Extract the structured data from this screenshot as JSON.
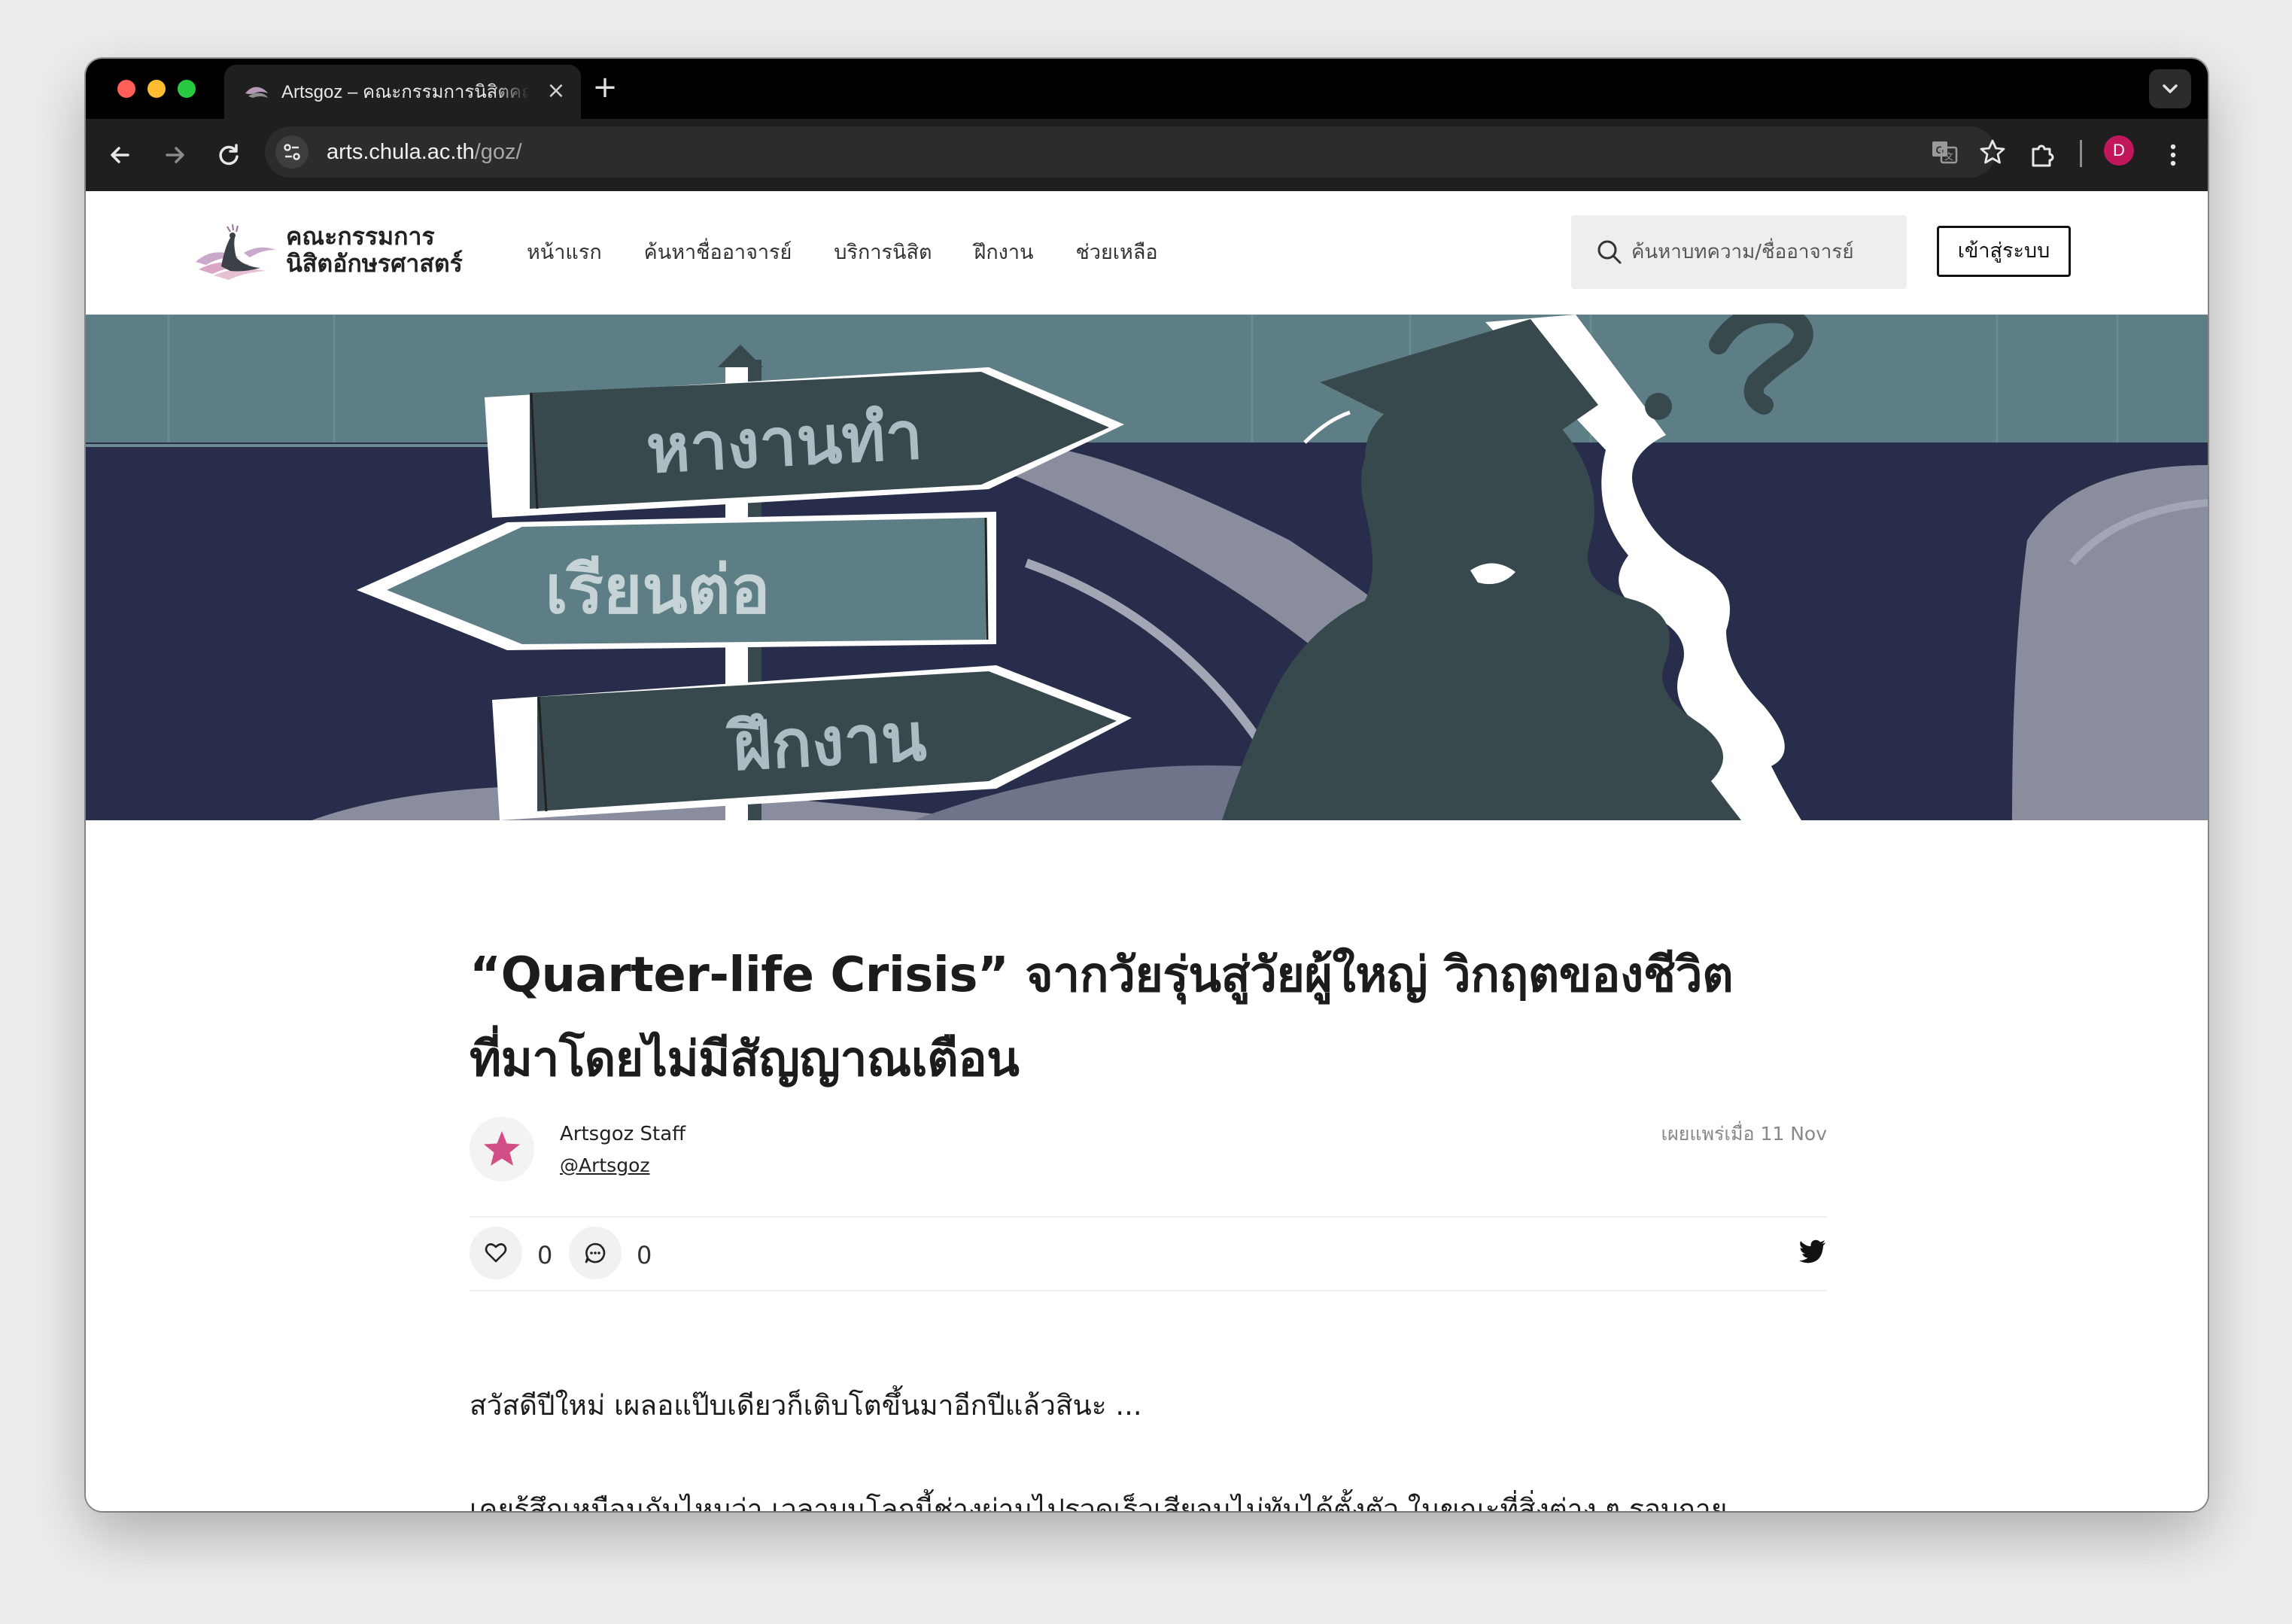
{
  "browser": {
    "tab_title": "Artsgoz – คณะกรรมการนิสิตคณะอักษรศาสตร์",
    "tab_close": "×",
    "new_tab": "+",
    "url_host": "arts.chula.ac.th",
    "url_path": "/goz/",
    "profile_initial": "D"
  },
  "site": {
    "logo_line1": "คณะกรรมการ",
    "logo_line2": "นิสิตอักษรศาสตร์",
    "nav": [
      {
        "label": "หน้าแรก"
      },
      {
        "label": "ค้นหาชื่ออาจารย์"
      },
      {
        "label": "บริการนิสิต"
      },
      {
        "label": "ฝึกงาน"
      },
      {
        "label": "ช่วยเหลือ"
      }
    ],
    "search_placeholder": "ค้นหาบทความ/ชื่ออาจารย์",
    "login_label": "เข้าสู่ระบบ"
  },
  "hero": {
    "sign_top": "หางานทำ",
    "sign_middle": "เรียนต่อ",
    "sign_bottom": "ฝึกงาน",
    "colors": {
      "sky": "#5e7e86",
      "ground": "#272d4a",
      "sign": "#37494d",
      "sign_mid": "#5e7e86",
      "road": "#8a8d9e"
    }
  },
  "article": {
    "title_line1": "“Quarter-life Crisis” จากวัยรุ่นสู่วัยผู้ใหญ่ วิกฤตของชีวิต",
    "title_line2": "ที่มาโดยไม่มีสัญญาณเตือน",
    "author_name": "Artsgoz Staff",
    "author_handle": "@Artsgoz",
    "published": "เผยแพร่เมื่อ 11 Nov",
    "likes": "0",
    "comments": "0",
    "paragraph1": "สวัสดีปีใหม่ เผลอแป๊บเดียวก็เติบโตขึ้นมาอีกปีแล้วสินะ ...",
    "paragraph2": "เคยรู้สึกเหมือนกันไหมว่า เวลาบนโลกนี้ช่างผ่านไปรวดเร็วเสียจนไม่ทันได้ตั้งตัว ในขณะที่สิ่งต่าง ๆ รอบกาย"
  },
  "colors": {
    "accent": "#c2185b",
    "star": "#d14f86"
  }
}
